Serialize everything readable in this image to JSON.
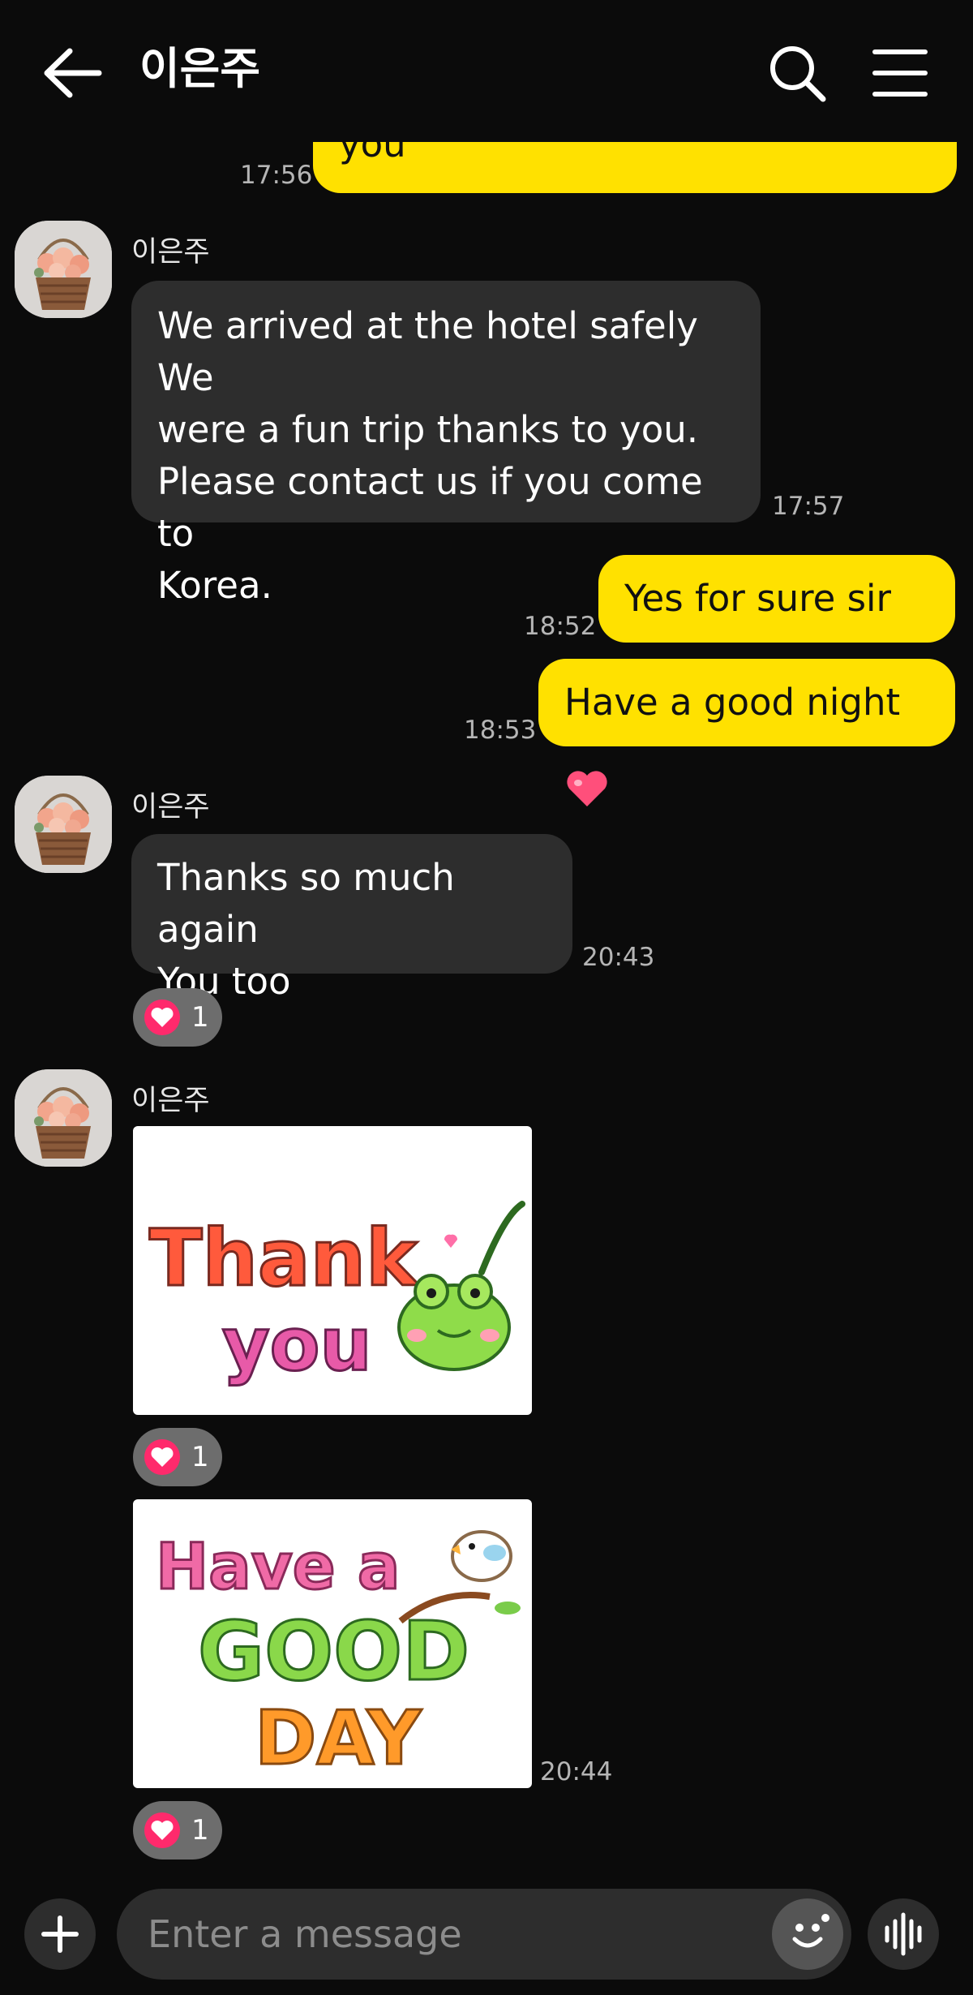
{
  "header": {
    "title": "이은주",
    "back_icon": "arrow-left-icon",
    "search_icon": "search-icon",
    "menu_icon": "hamburger-menu-icon"
  },
  "messages": [
    {
      "type": "outgoing",
      "text": "you",
      "time": "17:56"
    },
    {
      "type": "incoming",
      "sender": "이은주",
      "lines": [
        "We arrived at the hotel safely We",
        "were a fun trip thanks to you.",
        "Please contact us if you come to",
        "Korea."
      ],
      "time": "17:57"
    },
    {
      "type": "outgoing",
      "text": "Yes for sure sir ",
      "emoji": "heart",
      "time": "18:52"
    },
    {
      "type": "outgoing",
      "text": "Have a good night ",
      "emoji": "heart",
      "time": "18:53"
    },
    {
      "type": "incoming",
      "sender": "이은주",
      "lines": [
        "Thanks so much again",
        "You too"
      ],
      "time": "20:43",
      "reaction": {
        "icon": "heart-icon",
        "count": "1"
      }
    },
    {
      "type": "sticker",
      "sender": "이은주",
      "sticker_text": [
        "Thank",
        "you"
      ],
      "reaction": {
        "icon": "heart-icon",
        "count": "1"
      }
    },
    {
      "type": "sticker",
      "sticker_text": [
        "Have a",
        "GOOD",
        "DAY"
      ],
      "time": "20:44",
      "reaction": {
        "icon": "heart-icon",
        "count": "1"
      }
    }
  ],
  "input": {
    "placeholder": "Enter a message",
    "plus_icon": "plus-icon",
    "emoji_icon": "emoji-icon",
    "voice_icon": "voice-wave-icon"
  },
  "colors": {
    "background": "#0b0b0b",
    "outgoing_bubble": "#ffe100",
    "incoming_bubble": "#2d2d2d",
    "reaction_heart": "#ff2a6c"
  }
}
